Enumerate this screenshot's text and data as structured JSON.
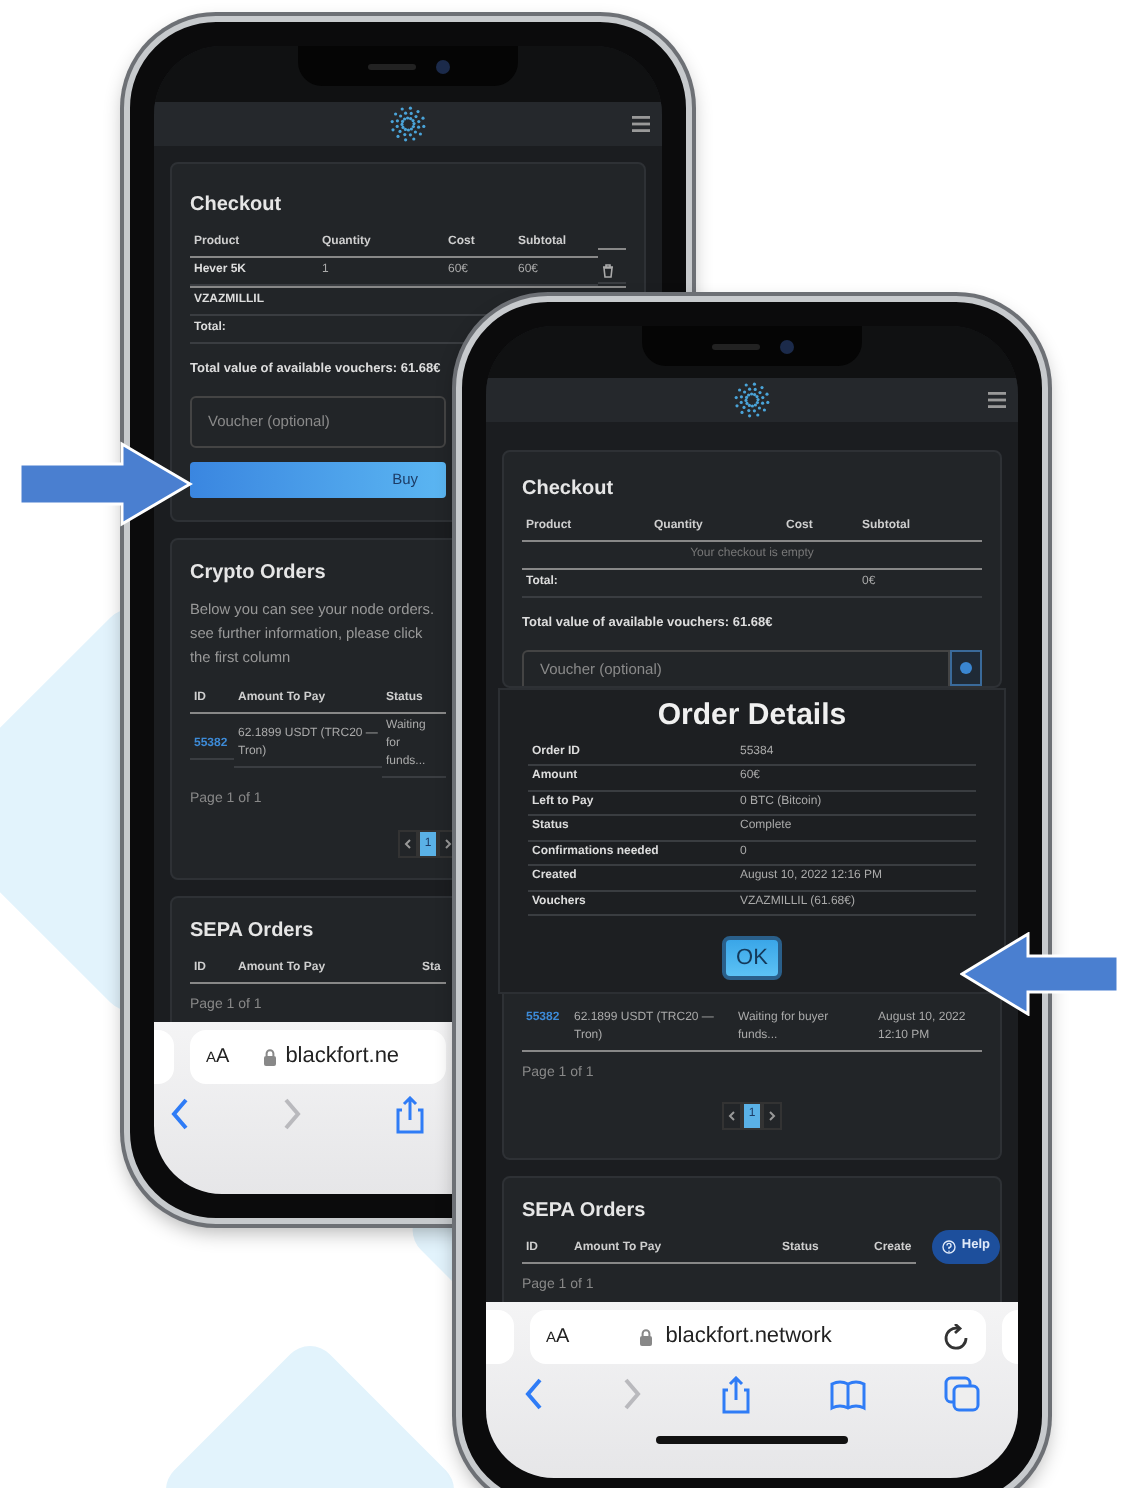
{
  "back_phone": {
    "checkout": {
      "title": "Checkout",
      "columns": [
        "Product",
        "Quantity",
        "Cost",
        "Subtotal"
      ],
      "rows": [
        [
          "Hever 5K",
          "1",
          "60€",
          "60€"
        ]
      ],
      "voucher_code": "VZAZMILLIL",
      "total_label": "Total:",
      "vouchers_note": "Total value of available vouchers: 61.68€",
      "voucher_field": {
        "placeholder": "Voucher (optional)"
      },
      "buy_button": "Buy"
    },
    "crypto_orders": {
      "title": "Crypto Orders",
      "description_lines": [
        "Below you can see your node orders.",
        "see further information, please click",
        "the first column"
      ],
      "columns": [
        "ID",
        "Amount To Pay",
        "Status"
      ],
      "rows": [
        {
          "id": "55382",
          "amount": "62.1899 USDT (TRC20 — Tron)",
          "status": "Waiting for funds..."
        }
      ],
      "page_info": "Page 1 of 1",
      "pages": [
        {
          "label": "1",
          "selected": true
        }
      ]
    },
    "sepa_orders": {
      "title": "SEPA Orders",
      "columns": [
        "ID",
        "Amount To Pay",
        "Sta"
      ],
      "page_info": "Page 1 of 1"
    },
    "browser": {
      "text_size_button": "AA",
      "url": "blackfort.ne"
    }
  },
  "front_phone": {
    "checkout": {
      "title": "Checkout",
      "columns": [
        "Product",
        "Quantity",
        "Cost",
        "Subtotal"
      ],
      "empty_message": "Your checkout is empty",
      "total_label": "Total:",
      "total_value": "0€",
      "vouchers_note": "Total value of available vouchers: 61.68€",
      "voucher_field": {
        "placeholder": "Voucher (optional)"
      }
    },
    "order_details": {
      "title": "Order Details",
      "rows": [
        {
          "label": "Order ID",
          "value": "55384"
        },
        {
          "label": "Amount",
          "value": "60€"
        },
        {
          "label": "Left to Pay",
          "value": "0 BTC (Bitcoin)"
        },
        {
          "label": "Status",
          "value": "Complete"
        },
        {
          "label": "Confirmations needed",
          "value": "0"
        },
        {
          "label": "Created",
          "value": "August 10, 2022 12:16 PM"
        },
        {
          "label": "Vouchers",
          "value": "VZAZMILLIL (61.68€)"
        }
      ],
      "ok_button": "OK"
    },
    "crypto_orders": {
      "rows": [
        {
          "id": "55382",
          "amount": "62.1899 USDT (TRC20 — Tron)",
          "status": "Waiting for buyer funds...",
          "created": "August 10, 2022 12:10 PM"
        }
      ],
      "page_info": "Page 1 of 1",
      "pages": [
        {
          "label": "1",
          "selected": true
        }
      ]
    },
    "sepa_orders": {
      "title": "SEPA Orders",
      "columns": [
        "ID",
        "Amount To Pay",
        "Status",
        "Create"
      ],
      "page_info": "Page 1 of 1"
    },
    "help_button": "Help",
    "browser": {
      "text_size_button": "AA",
      "url": "blackfort.network"
    }
  }
}
